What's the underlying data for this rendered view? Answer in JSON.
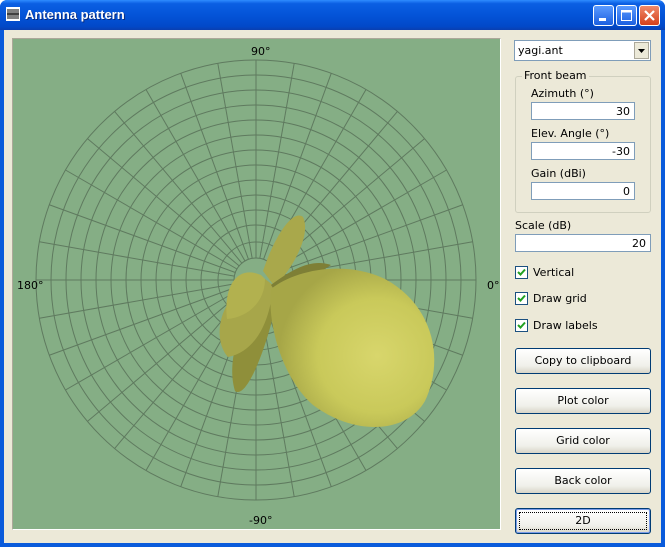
{
  "window": {
    "title": "Antenna pattern"
  },
  "plot": {
    "labels": {
      "top": "90°",
      "bottom": "-90°",
      "left": "180°",
      "right": "0°"
    },
    "colors": {
      "background": "#85ae85",
      "grid": "#5f7a5f",
      "lobe": "#d4d66a",
      "labels": "#6b886b"
    }
  },
  "controls": {
    "file_select": "yagi.ant",
    "front_beam": {
      "legend": "Front beam",
      "azimuth_label": "Azimuth (°)",
      "azimuth_value": "30",
      "elev_label": "Elev. Angle (°)",
      "elev_value": "-30",
      "gain_label": "Gain (dBi)",
      "gain_value": "0"
    },
    "scale_label": "Scale (dB)",
    "scale_value": "20",
    "checkboxes": {
      "vertical": {
        "label": "Vertical",
        "checked": true
      },
      "draw_grid": {
        "label": "Draw grid",
        "checked": true
      },
      "draw_labels": {
        "label": "Draw labels",
        "checked": true
      }
    },
    "buttons": {
      "copy": "Copy to clipboard",
      "plot_color": "Plot color",
      "grid_color": "Grid color",
      "back_color": "Back color",
      "mode_2d": "2D"
    }
  }
}
